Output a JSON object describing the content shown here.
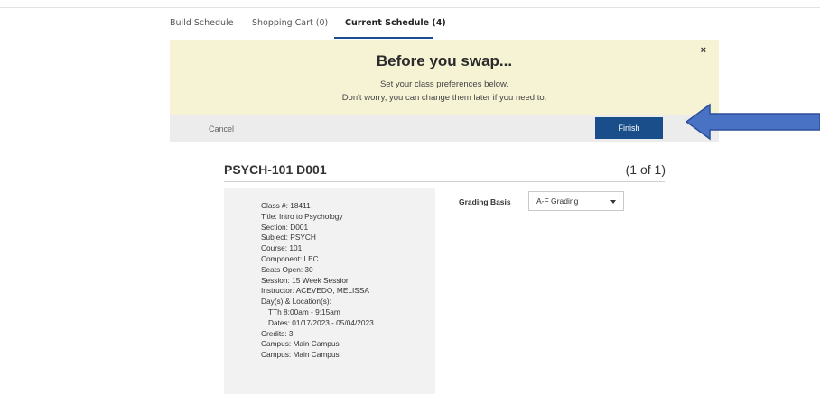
{
  "tabs": [
    {
      "label": "Build Schedule",
      "active": false
    },
    {
      "label": "Shopping Cart (0)",
      "active": false
    },
    {
      "label": "Current Schedule (4)",
      "active": true
    }
  ],
  "modal": {
    "close_label": "×",
    "title": "Before you swap...",
    "line1": "Set your class preferences below.",
    "line2": "Don't worry, you can change them later if you need to.",
    "cancel_label": "Cancel",
    "finish_label": "Finish"
  },
  "annotation_arrow_color": "#4a72c4",
  "course": {
    "title": "PSYCH-101 D001",
    "count": "(1 of 1)",
    "details": [
      "Class #: 18411",
      "Title: Intro to Psychology",
      "Section: D001",
      "Subject: PSYCH",
      "Course: 101",
      "Component: LEC",
      "Seats Open: 30",
      "Session: 15 Week Session",
      "Instructor: ACEVEDO, MELISSA",
      "Day(s) & Location(s):",
      "TTh 8:00am - 9:15am",
      "Dates: 01/17/2023 - 05/04/2023",
      "Credits: 3",
      "Campus: Main Campus",
      "Campus: Main Campus"
    ]
  },
  "grading": {
    "label": "Grading Basis",
    "value": "A-F Grading"
  },
  "colors": {
    "banner": "#f6f2d4",
    "primary": "#1a4e8a",
    "actionbar": "#ececec",
    "details_bg": "#f2f2f2"
  }
}
